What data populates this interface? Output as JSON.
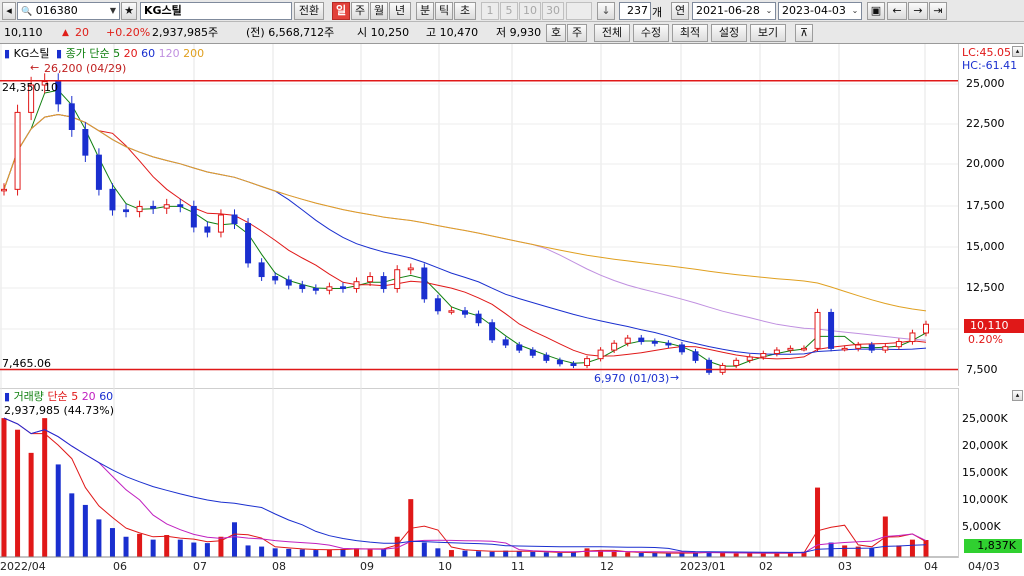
{
  "toolbar": {
    "code": "016380",
    "name": "KG스틸",
    "btn_convert": "전환",
    "periods": [
      "일",
      "주",
      "월",
      "년",
      "분",
      "틱",
      "초"
    ],
    "minute_steps": [
      "1",
      "5",
      "10",
      "30"
    ],
    "count": "237",
    "count_unit": "개",
    "year_label": "연",
    "date_from": "2021-06-28",
    "date_to": "2023-04-03",
    "btn_ho": "호",
    "btn_ju": "주",
    "btn_all": "전체",
    "btn_edit": "수정",
    "btn_recent": "최적",
    "btn_settings": "설정",
    "btn_view": "보기"
  },
  "quote": {
    "price": "10,110",
    "change": "20",
    "change_pct": "+0.20%",
    "volume": "2,937,985주",
    "prev_volume": "(전) 6,568,712주",
    "open": "시 10,250",
    "high": "고 10,470",
    "low": "저 9,930"
  },
  "price_legend": {
    "title": "KG스틸",
    "ma_prefix": "종가 단순",
    "ma_periods": [
      "5",
      "20",
      "60",
      "120",
      "200"
    ],
    "ma_colors": [
      "#108010",
      "#e01818",
      "#1a2fcf",
      "#c090e0",
      "#e0a020"
    ]
  },
  "annotations": {
    "hi_label": "26,200 (04/29)",
    "lo_label": "6,970 (01/03)",
    "hline_top": "24,350.10",
    "hline_bottom": "7,465.06",
    "lc": "LC:45.05",
    "hc": "HC:-61.41",
    "last_price": "10,110",
    "last_pct": "0.20%"
  },
  "volume_legend": {
    "title": "거래량",
    "ma_prefix": "단순",
    "ma_periods": [
      "5",
      "20",
      "60"
    ],
    "value": "2,937,985 (44.73%)",
    "last": "1,837K"
  },
  "price_axis": [
    "25,000",
    "22,500",
    "20,000",
    "17,500",
    "15,000",
    "12,500",
    "10,000",
    "7,500"
  ],
  "volume_axis": [
    "25,000K",
    "20,000K",
    "15,000K",
    "10,000K",
    "5,000K"
  ],
  "x_axis": [
    "2022/04",
    "06",
    "07",
    "08",
    "09",
    "10",
    "11",
    "12",
    "2023/01",
    "02",
    "03",
    "04",
    "04/03"
  ],
  "chart_data": {
    "type": "candlestick",
    "price_ylim": [
      6500,
      26500
    ],
    "volume_ylim": [
      0,
      28000
    ],
    "closes": [
      18000,
      22500,
      24100,
      24300,
      23000,
      21500,
      20000,
      18000,
      16800,
      16700,
      17000,
      16900,
      17100,
      17000,
      15800,
      15500,
      16500,
      16000,
      13700,
      12900,
      12700,
      12400,
      12200,
      12100,
      12300,
      12200,
      12600,
      12900,
      12200,
      13300,
      13400,
      11600,
      10900,
      10900,
      10700,
      10200,
      9200,
      8900,
      8600,
      8300,
      8000,
      7800,
      7700,
      8100,
      8600,
      9000,
      9300,
      9100,
      9000,
      8900,
      8500,
      8000,
      7300,
      7700,
      8000,
      8200,
      8400,
      8600,
      8700,
      8700,
      10800,
      8700,
      8700,
      8900,
      8600,
      8800,
      9100,
      9600,
      10110
    ],
    "volumes": [
      24000,
      22000,
      18000,
      24000,
      16000,
      11000,
      9000,
      6500,
      5000,
      3500,
      4000,
      3000,
      3800,
      3000,
      2500,
      2400,
      3500,
      6000,
      2000,
      1800,
      1500,
      1400,
      1300,
      1200,
      1300,
      1400,
      1500,
      1300,
      1400,
      3500,
      10000,
      2500,
      1500,
      1200,
      1100,
      1000,
      900,
      1100,
      1000,
      900,
      800,
      700,
      900,
      1500,
      1000,
      900,
      800,
      700,
      700,
      600,
      700,
      800,
      900,
      700,
      600,
      700,
      600,
      600,
      700,
      900,
      12000,
      2500,
      2000,
      1800,
      1500,
      7000,
      2000,
      3000,
      2938
    ]
  }
}
